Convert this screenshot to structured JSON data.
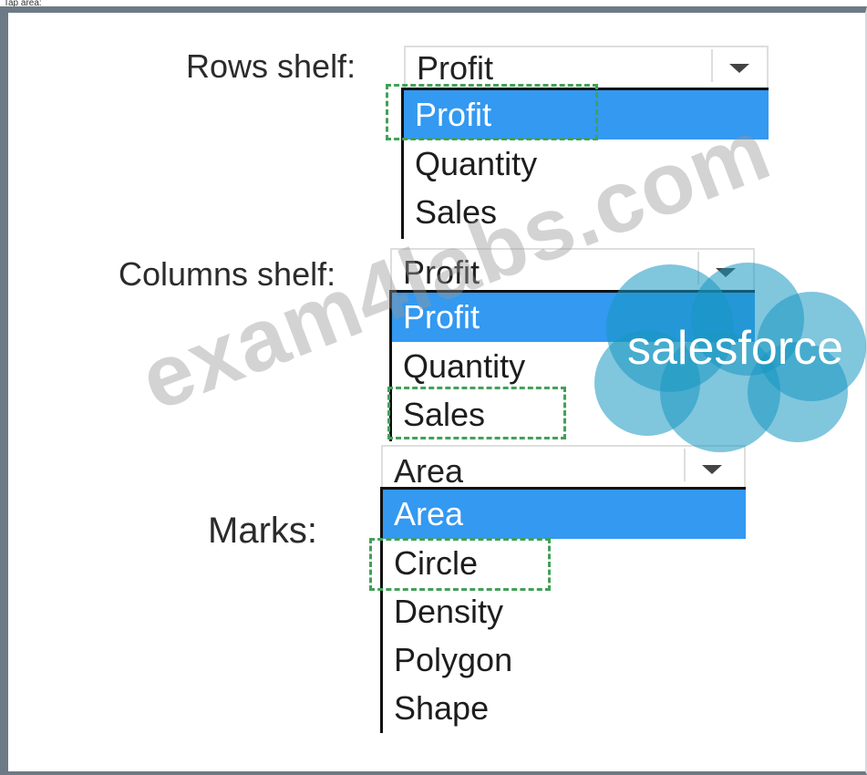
{
  "top_caption": "Tap area:",
  "rows": {
    "label": "Rows shelf:",
    "selected": "Profit",
    "options": [
      "Profit",
      "Quantity",
      "Sales"
    ],
    "highlighted_index": 0
  },
  "columns": {
    "label": "Columns shelf:",
    "selected": "Profit",
    "options": [
      "Profit",
      "Quantity",
      "Sales"
    ],
    "highlighted_index": 0
  },
  "marks": {
    "label": "Marks:",
    "selected": "Area",
    "options": [
      "Area",
      "Circle",
      "Density",
      "Polygon",
      "Shape"
    ],
    "highlighted_index": 0
  },
  "watermark": {
    "text": "exam4labs.com",
    "logo": "salesforce"
  },
  "colors": {
    "frame": "#6d7a86",
    "highlight": "#3399f1",
    "answer_box": "#43a05a",
    "cloud": "#1798c1"
  }
}
